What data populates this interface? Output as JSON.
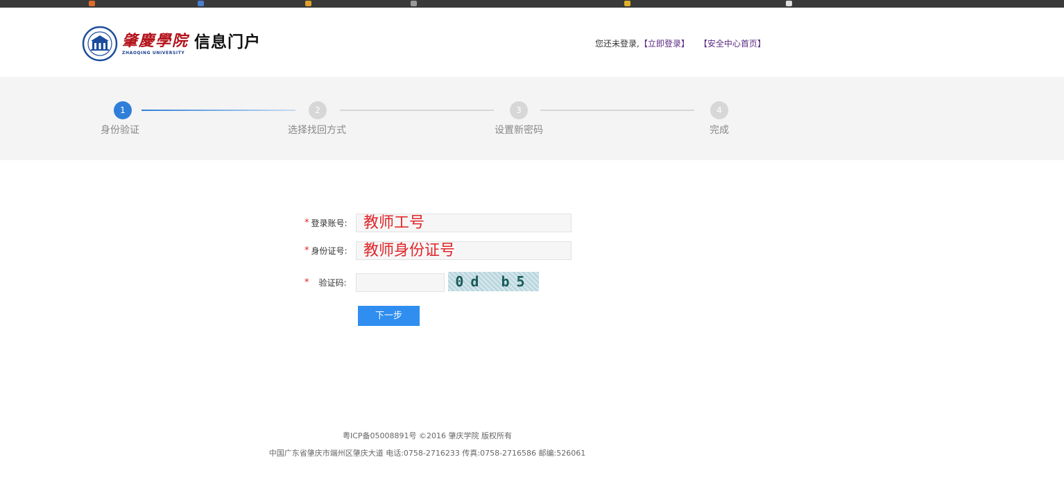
{
  "logo": {
    "school_cn": "肇慶學院",
    "school_en": "ZHAOQING UNIVERSITY",
    "portal_title": "信息门户"
  },
  "login_status": {
    "prefix": "您还未登录,",
    "login_link": "【立即登录】",
    "security_link": "【安全中心首页】"
  },
  "steps": [
    {
      "number": "1",
      "label": "身份验证"
    },
    {
      "number": "2",
      "label": "选择找回方式"
    },
    {
      "number": "3",
      "label": "设置新密码"
    },
    {
      "number": "4",
      "label": "完成"
    }
  ],
  "current_step": 1,
  "form": {
    "required_mark": "*",
    "account_label": "登录账号:",
    "account_value": "教师工号",
    "id_label": "身份证号:",
    "id_value": "教师身份证号",
    "captcha_label": "验证码:",
    "captcha_value": "",
    "captcha_text": "0d b5",
    "next_button": "下一步"
  },
  "footer": {
    "line1": "粤ICP备05008891号 ©2016 肇庆学院 版权所有",
    "line2": "中国广东省肇庆市端州区肇庆大道 电话:0758-2716233 传真:0758-2716586 邮编:526061"
  },
  "colors": {
    "accent": "#2f7fd8",
    "button": "#2f8eef",
    "required": "#e02020",
    "link": "#5b2b82",
    "logo_red": "#b3121a"
  }
}
